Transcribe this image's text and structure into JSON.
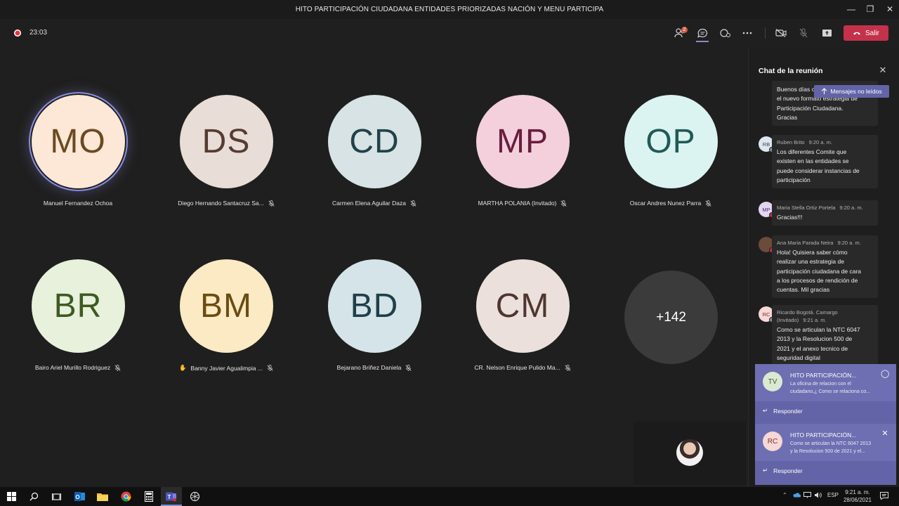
{
  "window": {
    "title": "HITO PARTICIPACIÓN CIUDADANA ENTIDADES PRIORIZADAS NACIÓN Y MENU PARTICIPA"
  },
  "toolbar": {
    "timer": "23:03",
    "participants_badge": "2",
    "leave_label": "Salir"
  },
  "participants": [
    {
      "initials": "MO",
      "name": "Manuel Fernandez Ochoa",
      "bg": "#fde7d6",
      "fg": "#6a4a20",
      "muted": false,
      "speaking": true,
      "hand": false
    },
    {
      "initials": "DS",
      "name": "Diego Hernando Santacruz Sa...",
      "bg": "#e9ddd7",
      "fg": "#553c32",
      "muted": true,
      "speaking": false,
      "hand": false
    },
    {
      "initials": "CD",
      "name": "Carmen Elena Aguilar Daza",
      "bg": "#d7e3e4",
      "fg": "#22414a",
      "muted": true,
      "speaking": false,
      "hand": false
    },
    {
      "initials": "MP",
      "name": "MARTHA POLANIA (Invitado)",
      "bg": "#f3d0dc",
      "fg": "#6a1d3c",
      "muted": true,
      "speaking": false,
      "hand": false
    },
    {
      "initials": "OP",
      "name": "Oscar Andres Nunez Parra",
      "bg": "#dcf4f1",
      "fg": "#1f5a56",
      "muted": true,
      "speaking": false,
      "hand": false
    },
    {
      "initials": "BR",
      "name": "Bairo Ariel Murillo Rodriguez",
      "bg": "#e7f1dc",
      "fg": "#3d5a22",
      "muted": true,
      "speaking": false,
      "hand": false
    },
    {
      "initials": "BM",
      "name": "Banny Javier Agualimpia ...",
      "bg": "#fbeac4",
      "fg": "#6a4c12",
      "muted": true,
      "speaking": false,
      "hand": true
    },
    {
      "initials": "BD",
      "name": "Bejarano Briñez Daniela",
      "bg": "#d5e4e8",
      "fg": "#1f3f4a",
      "muted": true,
      "speaking": false,
      "hand": false
    },
    {
      "initials": "CM",
      "name": "CR. Nelson Enrique Pulido Ma...",
      "bg": "#ece0dc",
      "fg": "#4e362e",
      "muted": true,
      "speaking": false,
      "hand": false
    }
  ],
  "more_participants": "+142",
  "chat": {
    "title": "Chat de la reunión",
    "unread_label": "Mensajes no leídos",
    "messages": [
      {
        "initials": "",
        "author": "",
        "time": "",
        "lines": [
          "Buenos días c",
          "el nuevo formato estrategia de",
          "Participación Ciudadana.",
          "Gracias"
        ]
      },
      {
        "initials": "RB",
        "author": "Ruben Brito",
        "time": "9:20 a. m.",
        "lines": [
          "Los diferentes Comite que",
          "existen en las entidades se",
          "puede considerar instancias de",
          "participación"
        ]
      },
      {
        "initials": "MP",
        "author": "Maria Stella Ortiz Portela",
        "time": "9:20 a. m.",
        "lines": [
          "Gracias!!!"
        ]
      },
      {
        "initials": "",
        "author": "Ana Maria Parada Neira",
        "time": "9:20 a. m.",
        "lines": [
          "Hola! Quisiera saber cómo",
          "realizar una estrategia de",
          "participación ciudadana de cara",
          "a los procesos de rendición de",
          "cuentas. Mil gracias"
        ]
      },
      {
        "initials": "RC",
        "author": "Ricardo Bogotá. Camargo",
        "author2": "(Invitado)",
        "time": "9:21 a. m.",
        "lines": [
          "Como se articulan la NTC 6047",
          "2013 y la Resolucion 500 de",
          "2021 y el anexo tecnico de",
          "seguridad digital"
        ]
      }
    ]
  },
  "notifications": [
    {
      "initials": "TV",
      "title": "HITO PARTICIPACIÓN...",
      "body1": "La oficina de relacion con el",
      "body2": "ciudadano,¿ Como se relaciona co...",
      "reply": "Responder"
    },
    {
      "initials": "RC",
      "title": "HITO PARTICIPACIÓN...",
      "body1": "Como se articulan la NTC 6047 2013",
      "body2": "y la Resolucion 500 de 2021 y el...",
      "reply": "Responder"
    }
  ],
  "taskbar": {
    "lang": "ESP",
    "time": "9:21 a. m.",
    "date": "28/06/2021"
  }
}
